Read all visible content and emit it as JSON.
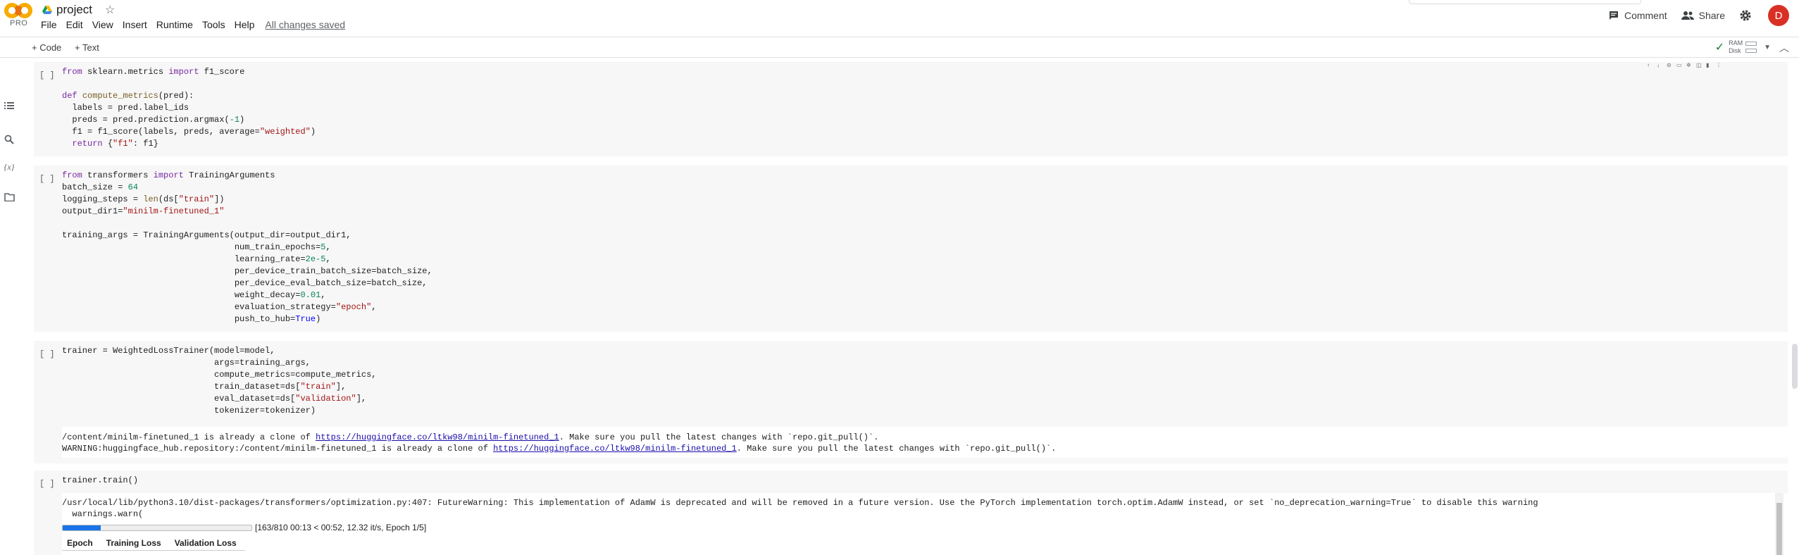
{
  "header": {
    "brand_badge": "PRO",
    "doc_title": "project",
    "menu": [
      "File",
      "Edit",
      "View",
      "Insert",
      "Runtime",
      "Tools",
      "Help"
    ],
    "save_status": "All changes saved",
    "comment_label": "Comment",
    "share_label": "Share",
    "avatar_letter": "D"
  },
  "toolbar": {
    "add_code_label": "+ Code",
    "add_text_label": "+ Text",
    "ram_label": "RAM",
    "disk_label": "Disk"
  },
  "cells": [
    {
      "run_indicator": "[ ]",
      "code_lines": [
        "from sklearn.metrics import f1_score",
        "",
        "def compute_metrics(pred):",
        "  labels = pred.label_ids",
        "  preds = pred.prediction.argmax(-1)",
        "  f1 = f1_score(labels, preds, average=\"weighted\")",
        "  return {\"f1\": f1}"
      ]
    },
    {
      "run_indicator": "[ ]",
      "code_lines": [
        "from transformers import TrainingArguments",
        "batch_size = 64",
        "logging_steps = len(ds[\"train\"])",
        "output_dir1=\"minilm-finetuned_1\"",
        "",
        "training_args = TrainingArguments(output_dir=output_dir1,",
        "                                  num_train_epochs=5,",
        "                                  learning_rate=2e-5,",
        "                                  per_device_train_batch_size=batch_size,",
        "                                  per_device_eval_batch_size=batch_size,",
        "                                  weight_decay=0.01,",
        "                                  evaluation_strategy=\"epoch\",",
        "                                  push_to_hub=True)"
      ]
    },
    {
      "run_indicator": "[ ]",
      "code_lines": [
        "trainer = WeightedLossTrainer(model=model,",
        "                              args=training_args,",
        "                              compute_metrics=compute_metrics,",
        "                              train_dataset=ds[\"train\"],",
        "                              eval_dataset=ds[\"validation\"],",
        "                              tokenizer=tokenizer)"
      ],
      "output": {
        "line1_prefix": "/content/minilm-finetuned_1 is already a clone of ",
        "line1_link": "https://huggingface.co/ltkw98/minilm-finetuned_1",
        "line1_suffix": ". Make sure you pull the latest changes with `repo.git_pull()`.",
        "line2_prefix": "WARNING:huggingface_hub.repository:/content/minilm-finetuned_1 is already a clone of ",
        "line2_link": "https://huggingface.co/ltkw98/minilm-finetuned_1",
        "line2_suffix": ". Make sure you pull the latest changes with `repo.git_pull()`."
      }
    },
    {
      "run_indicator": "[ ]",
      "code_lines": [
        "trainer.train()"
      ],
      "output": {
        "warning_line1": "/usr/local/lib/python3.10/dist-packages/transformers/optimization.py:407: FutureWarning: This implementation of AdamW is deprecated and will be removed in a future version. Use the PyTorch implementation torch.optim.AdamW instead, or set `no_deprecation_warning=True` to disable this warning",
        "warning_line2": "  warnings.warn(",
        "progress_fraction": 0.2012,
        "progress_text": "[163/810 00:13 < 00:52, 12.32 it/s, Epoch 1/5]",
        "table_headers": [
          "Epoch",
          "Training Loss",
          "Validation Loss"
        ]
      }
    }
  ]
}
